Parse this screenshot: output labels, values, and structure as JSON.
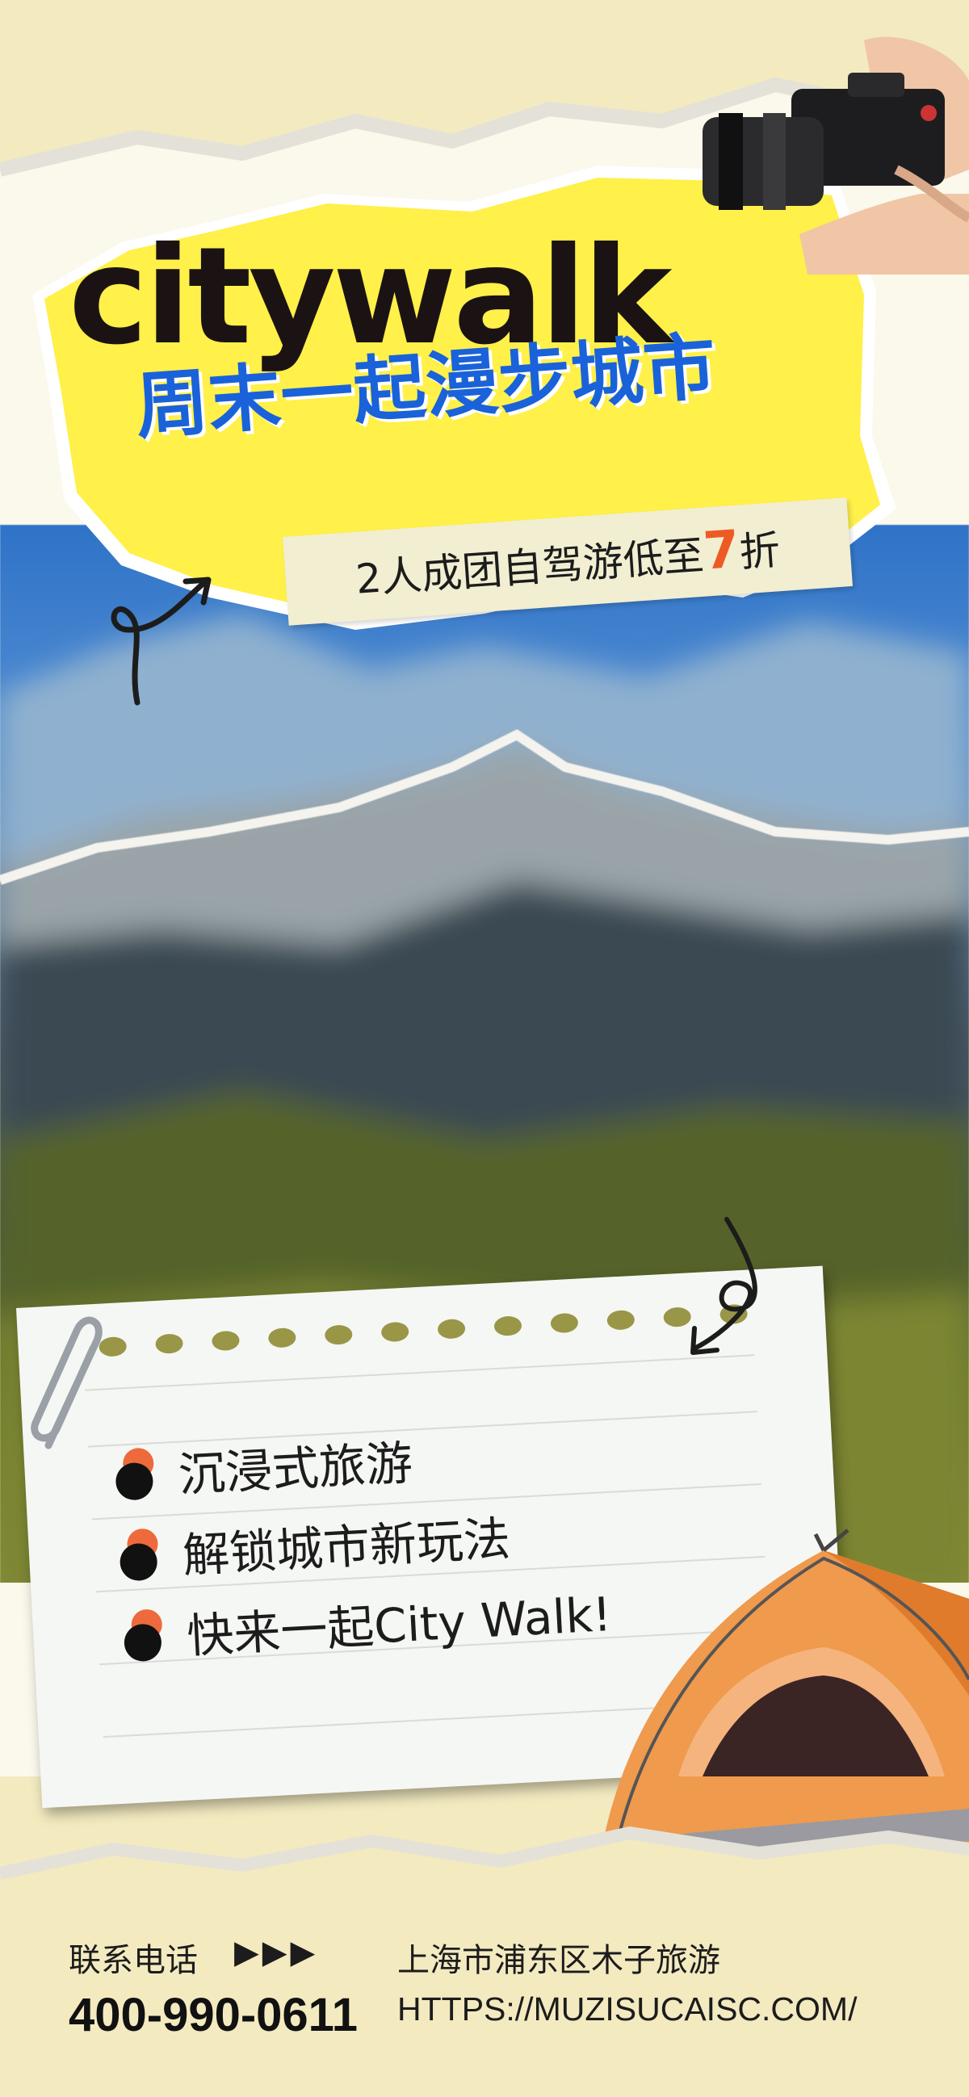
{
  "poster": {
    "title_main": "citywalk",
    "title_sub": "周末一起漫步城市",
    "promo_prefix": "2人成团自驾游低至",
    "promo_number": "7",
    "promo_suffix": "折"
  },
  "note": {
    "items": [
      {
        "text": "沉浸式旅游"
      },
      {
        "text": "解锁城市新玩法"
      },
      {
        "text": "快来一起City Walk!"
      }
    ]
  },
  "footer": {
    "contact_label": "联系电话",
    "arrows": "▶▶▶",
    "phone": "400-990-0611",
    "address": "上海市浦东区木子旅游",
    "url": "HTTPS://MUZISUCAISC.COM/"
  },
  "colors": {
    "title_yellow": "#fff04a",
    "title_blue": "#1a62d9",
    "accent_orange": "#ee5a24",
    "paper_cream": "#fbf8ec"
  },
  "icons": [
    "camera-icon",
    "tent-icon",
    "paperclip-icon",
    "squiggle-arrow-icon"
  ]
}
